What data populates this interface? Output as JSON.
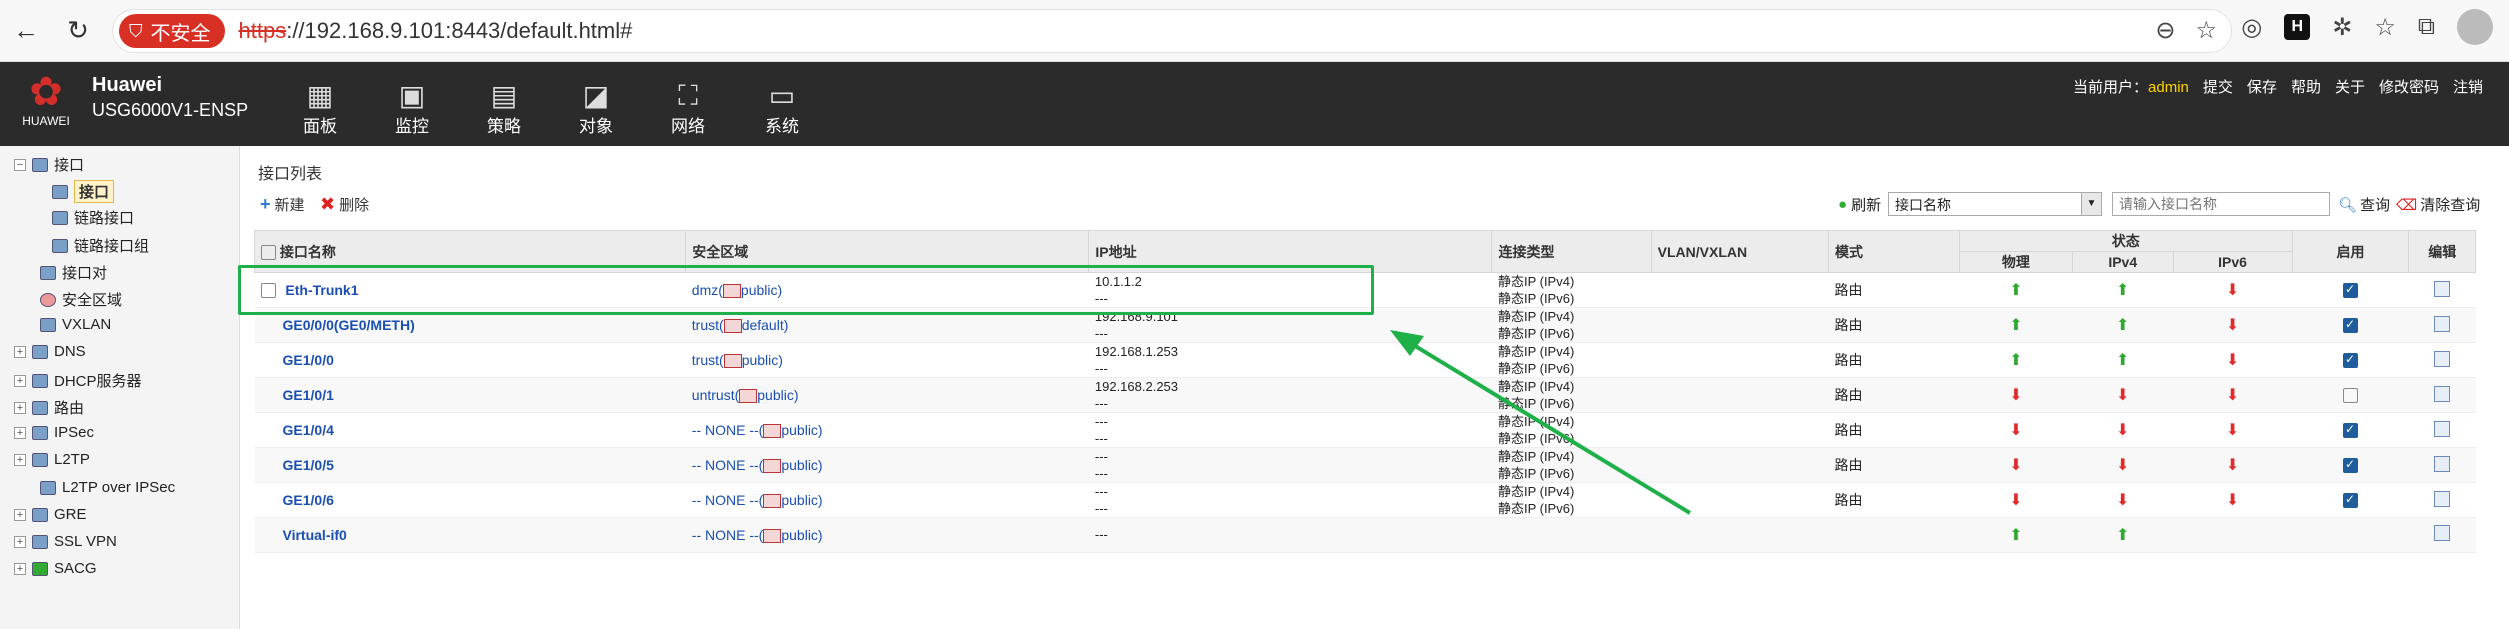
{
  "browser": {
    "insecure_label": "不安全",
    "url_scheme": "https",
    "url_rest": "://192.168.9.101:8443/default.html#",
    "ext_label": "H"
  },
  "app": {
    "logo_text": "HUAWEI",
    "brand": "Huawei",
    "model": "USG6000V1-ENSP",
    "nav": [
      "面板",
      "监控",
      "策略",
      "对象",
      "网络",
      "系统"
    ],
    "user_label": "当前用户：",
    "user": "admin",
    "links": [
      "提交",
      "保存",
      "帮助",
      "关于",
      "修改密码",
      "注销"
    ]
  },
  "sidebar": {
    "items": [
      {
        "label": "接口"
      },
      {
        "label": "接口"
      },
      {
        "label": "链路接口"
      },
      {
        "label": "链路接口组"
      },
      {
        "label": "接口对"
      },
      {
        "label": "安全区域"
      },
      {
        "label": "VXLAN"
      },
      {
        "label": "DNS"
      },
      {
        "label": "DHCP服务器"
      },
      {
        "label": "路由"
      },
      {
        "label": "IPSec"
      },
      {
        "label": "L2TP"
      },
      {
        "label": "L2TP over IPSec"
      },
      {
        "label": "GRE"
      },
      {
        "label": "SSL VPN"
      },
      {
        "label": "SACG"
      }
    ]
  },
  "main": {
    "title": "接口列表",
    "new": "新建",
    "delete": "删除",
    "refresh": "刷新",
    "select_value": "接口名称",
    "search_placeholder": "请输入接口名称",
    "query": "查询",
    "clear": "清除查询",
    "headers": {
      "name": "接口名称",
      "zone": "安全区域",
      "ip": "IP地址",
      "ctype": "连接类型",
      "vlan": "VLAN/VXLAN",
      "mode": "模式",
      "status": "状态",
      "phys": "物理",
      "ipv4": "IPv4",
      "ipv6": "IPv6",
      "enable": "启用",
      "edit": "编辑"
    },
    "rows": [
      {
        "name": "Eth-Trunk1",
        "zone": "dmz(",
        "vsys": "public)",
        "ip1": "10.1.1.2",
        "ip2": "---",
        "ct1": "静态IP (IPv4)",
        "ct2": "静态IP (IPv6)",
        "mode": "路由",
        "phys": "up",
        "ipv4": "up",
        "ipv6": "down",
        "enabled": true
      },
      {
        "name": "GE0/0/0(GE0/METH)",
        "zone": "trust(",
        "vsys": "default)",
        "ip1": "192.168.9.101",
        "ip2": "---",
        "ct1": "静态IP (IPv4)",
        "ct2": "静态IP (IPv6)",
        "mode": "路由",
        "phys": "up",
        "ipv4": "up",
        "ipv6": "down",
        "enabled": true
      },
      {
        "name": "GE1/0/0",
        "zone": "trust(",
        "vsys": "public)",
        "ip1": "192.168.1.253",
        "ip2": "---",
        "ct1": "静态IP (IPv4)",
        "ct2": "静态IP (IPv6)",
        "mode": "路由",
        "phys": "up",
        "ipv4": "up",
        "ipv6": "down",
        "enabled": true
      },
      {
        "name": "GE1/0/1",
        "zone": "untrust(",
        "vsys": "public)",
        "ip1": "192.168.2.253",
        "ip2": "---",
        "ct1": "静态IP (IPv4)",
        "ct2": "静态IP (IPv6)",
        "mode": "路由",
        "phys": "down",
        "ipv4": "down",
        "ipv6": "down",
        "enabled": false
      },
      {
        "name": "GE1/0/4",
        "zone": "-- NONE --(",
        "vsys": "public)",
        "ip1": "---",
        "ip2": "---",
        "ct1": "静态IP (IPv4)",
        "ct2": "静态IP (IPv6)",
        "mode": "路由",
        "phys": "down",
        "ipv4": "down",
        "ipv6": "down",
        "enabled": true
      },
      {
        "name": "GE1/0/5",
        "zone": "-- NONE --(",
        "vsys": "public)",
        "ip1": "---",
        "ip2": "---",
        "ct1": "静态IP (IPv4)",
        "ct2": "静态IP (IPv6)",
        "mode": "路由",
        "phys": "down",
        "ipv4": "down",
        "ipv6": "down",
        "enabled": true
      },
      {
        "name": "GE1/0/6",
        "zone": "-- NONE --(",
        "vsys": "public)",
        "ip1": "---",
        "ip2": "---",
        "ct1": "静态IP (IPv4)",
        "ct2": "静态IP (IPv6)",
        "mode": "路由",
        "phys": "down",
        "ipv4": "down",
        "ipv6": "down",
        "enabled": true
      },
      {
        "name": "Virtual-if0",
        "zone": "-- NONE --(",
        "vsys": "public)",
        "ip1": "---",
        "ip2": "",
        "ct1": "",
        "ct2": "",
        "mode": "",
        "phys": "up",
        "ipv4": "up",
        "ipv6": "",
        "enabled": null
      }
    ]
  },
  "colors": {
    "annotation": "#1fb04a",
    "header_bg": "#2b2b2b",
    "link": "#1a4fb0"
  }
}
